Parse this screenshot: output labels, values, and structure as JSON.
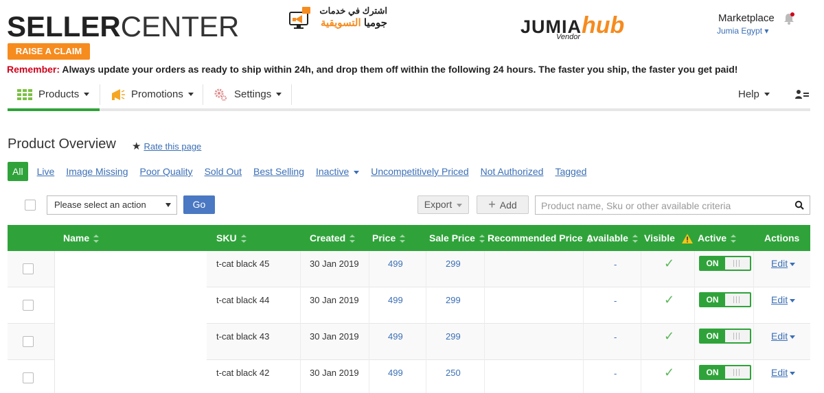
{
  "header": {
    "logo_bold": "SELLER",
    "logo_light": "CENTER",
    "raise_claim": "RAISE A CLAIM",
    "promo_line1": "اشترك في خدمات",
    "promo_line2a": "جوميا",
    "promo_line2b": "التسويقية",
    "hub_jumia": "JUMIA",
    "hub_hub": "hub",
    "hub_vendor": "Vendor",
    "marketplace": "Marketplace",
    "country": "Jumia Egypt ▾",
    "accent_color": "#f68b1e"
  },
  "reminder": {
    "label": "Remember:",
    "text": "Always update your orders as ready to ship within 24h, and drop them off within the following 24 hours. The faster you ship, the faster you get paid!"
  },
  "nav": {
    "products": "Products",
    "promotions": "Promotions",
    "settings": "Settings",
    "help": "Help"
  },
  "page": {
    "title": "Product Overview",
    "rate": "Rate this page"
  },
  "filters": {
    "all": "All",
    "live": "Live",
    "image_missing": "Image Missing",
    "poor_quality": "Poor Quality",
    "sold_out": "Sold Out",
    "best_selling": "Best Selling",
    "inactive": "Inactive",
    "uncompetitive": "Uncompetitively Priced",
    "not_authorized": "Not Authorized",
    "tagged": "Tagged"
  },
  "toolbar": {
    "select_action": "Please select an action",
    "go": "Go",
    "export": "Export",
    "add": "Add",
    "search_placeholder": "Product name, Sku or other available criteria"
  },
  "table": {
    "headers": {
      "name": "Name",
      "sku": "SKU",
      "created": "Created",
      "price": "Price",
      "sale_price": "Sale Price",
      "recommended_price": "Recommended Price",
      "available": "Available",
      "visible": "Visible",
      "active": "Active",
      "actions": "Actions"
    },
    "rows": [
      {
        "sku": "t-cat black 45",
        "created": "30 Jan 2019",
        "price": "499",
        "sale": "299",
        "available": "-",
        "active": "ON",
        "edit": "Edit"
      },
      {
        "sku": "t-cat black 44",
        "created": "30 Jan 2019",
        "price": "499",
        "sale": "299",
        "available": "-",
        "active": "ON",
        "edit": "Edit"
      },
      {
        "sku": "t-cat black 43",
        "created": "30 Jan 2019",
        "price": "499",
        "sale": "299",
        "available": "-",
        "active": "ON",
        "edit": "Edit"
      },
      {
        "sku": "t-cat black 42",
        "created": "30 Jan 2019",
        "price": "499",
        "sale": "250",
        "available": "-",
        "active": "ON",
        "edit": "Edit"
      }
    ]
  },
  "colors": {
    "green": "#2fa33a",
    "link_blue": "#3b6fb6",
    "orange": "#f68b1e",
    "red": "#d0021b"
  }
}
